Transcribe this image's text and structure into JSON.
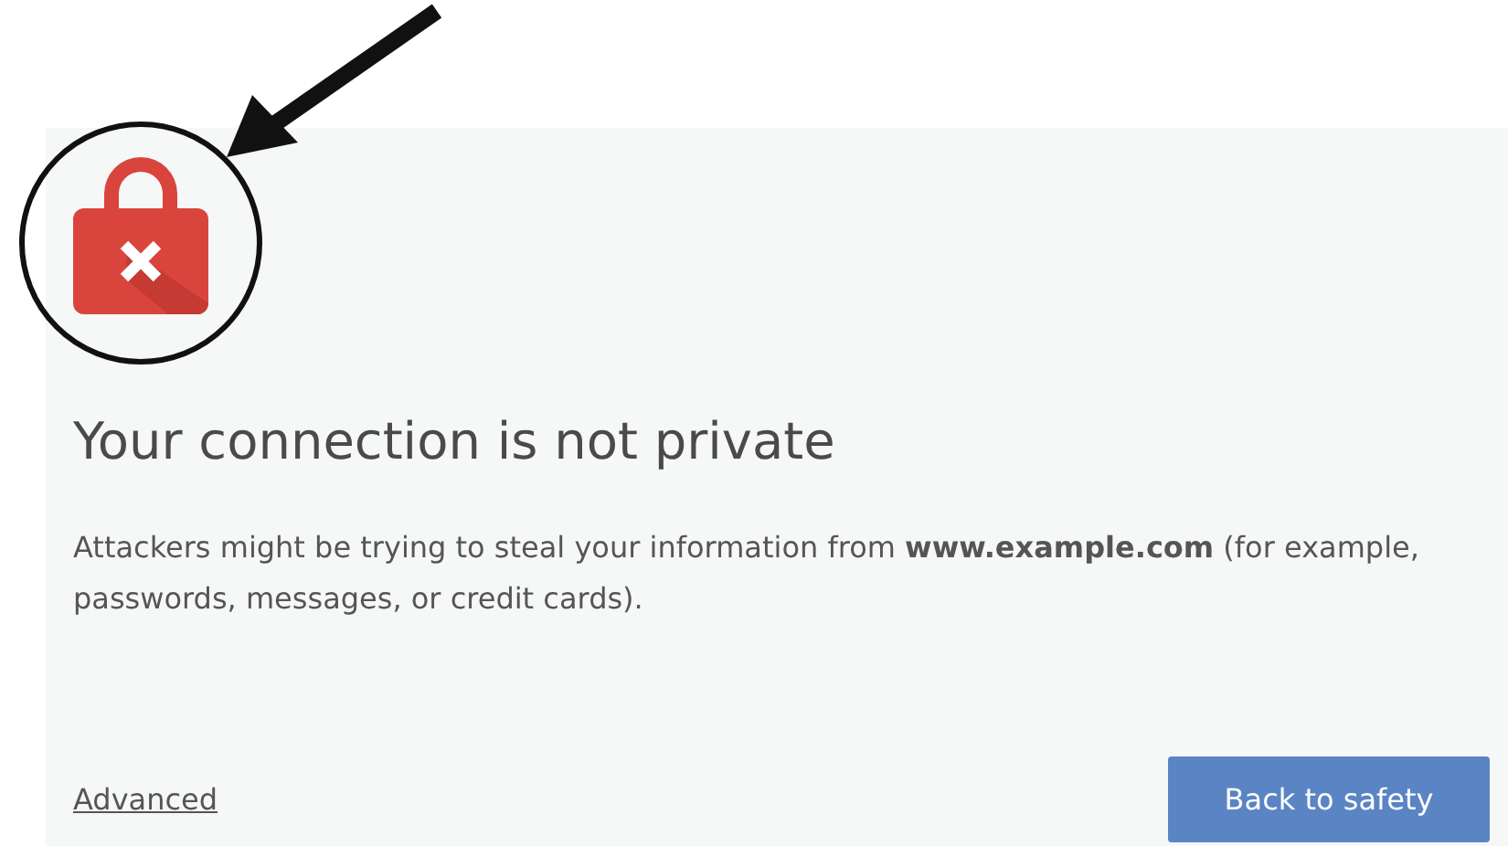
{
  "title": "Your connection is not private",
  "message": "Attackers might be trying to steal your information from **www.example.com** (for example, passwords, messages, or credit cards).",
  "advanced_link": "Advanced",
  "primary_button": "Back to safety"
}
